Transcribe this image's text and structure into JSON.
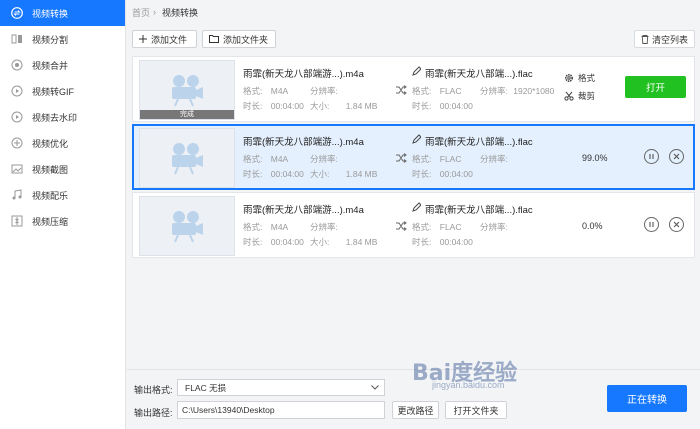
{
  "sidebar": {
    "items": [
      {
        "label": "视频转换",
        "icon": "convert-icon",
        "active": true
      },
      {
        "label": "视频分割",
        "icon": "split-icon",
        "active": false
      },
      {
        "label": "视频合并",
        "icon": "merge-icon",
        "active": false
      },
      {
        "label": "视频转GIF",
        "icon": "gif-icon",
        "active": false
      },
      {
        "label": "视频去水印",
        "icon": "watermark-icon",
        "active": false
      },
      {
        "label": "视频优化",
        "icon": "optimize-icon",
        "active": false
      },
      {
        "label": "视频截图",
        "icon": "screenshot-icon",
        "active": false
      },
      {
        "label": "视频配乐",
        "icon": "music-icon",
        "active": false
      },
      {
        "label": "视频压缩",
        "icon": "compress-icon",
        "active": false
      }
    ]
  },
  "breadcrumb": {
    "home": "首页",
    "separator": "›",
    "current": "视频转换"
  },
  "toolbar": {
    "add_file": "添加文件",
    "add_folder": "添加文件夹",
    "clear_list": "清空列表"
  },
  "labels": {
    "format": "格式:",
    "resolution": "分辨率:",
    "duration": "时长:",
    "size": "大小:",
    "settings": "格式",
    "cut": "裁剪",
    "open": "打开"
  },
  "files": [
    {
      "src_name": "雨霏(新天龙八部端游...).m4a",
      "src_format": "M4A",
      "src_resolution": "",
      "src_duration": "00:04:00",
      "src_size": "1.84 MB",
      "dst_name": "雨霏(新天龙八部端...).flac",
      "dst_format": "FLAC",
      "dst_resolution": "1920*1080",
      "dst_duration": "00:04:00",
      "status": "完成",
      "progress": ""
    },
    {
      "src_name": "雨霏(新天龙八部端游...).m4a",
      "src_format": "M4A",
      "src_resolution": "",
      "src_duration": "00:04:00",
      "src_size": "1.84 MB",
      "dst_name": "雨霏(新天龙八部端...).flac",
      "dst_format": "FLAC",
      "dst_resolution": "",
      "dst_duration": "00:04:00",
      "status": "",
      "progress": "99.0%"
    },
    {
      "src_name": "雨霏(新天龙八部端游...).m4a",
      "src_format": "M4A",
      "src_resolution": "",
      "src_duration": "00:04:00",
      "src_size": "1.84 MB",
      "dst_name": "雨霏(新天龙八部端...).flac",
      "dst_format": "FLAC",
      "dst_resolution": "",
      "dst_duration": "00:04:00",
      "status": "",
      "progress": "0.0%"
    }
  ],
  "bottom": {
    "output_format_label": "输出格式:",
    "output_format_value": "FLAC  无损",
    "output_path_label": "输出路径:",
    "output_path_value": "C:\\Users\\13940\\Desktop",
    "change_path": "更改路径",
    "open_folder": "打开文件夹",
    "start_convert": "正在转换"
  },
  "watermark": {
    "text": "Bai度经验",
    "sub": "jingyan.baidu.com"
  },
  "colors": {
    "accent": "#1677ff",
    "open_green": "#21c121"
  }
}
